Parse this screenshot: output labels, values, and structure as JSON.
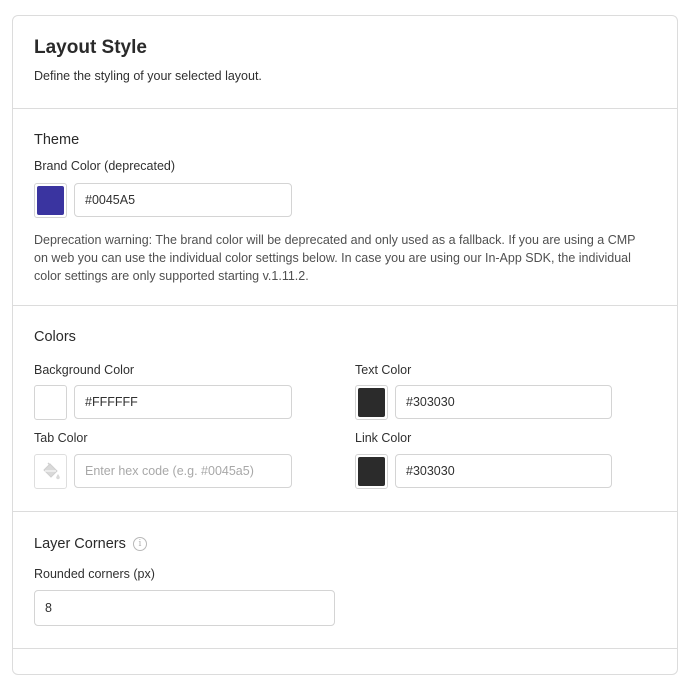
{
  "header": {
    "title": "Layout Style",
    "description": "Define the styling of your selected layout."
  },
  "theme": {
    "title": "Theme",
    "brand_color_label": "Brand Color (deprecated)",
    "brand_color_value": "#0045A5",
    "brand_swatch_color": "#3a34a0",
    "warning": "Deprecation warning: The brand color will be deprecated and only used as a fallback. If you are using a CMP on web you can use the individual color settings below. In case you are using our In-App SDK, the individual color settings are only supported starting v.1.11.2."
  },
  "colors": {
    "title": "Colors",
    "background": {
      "label": "Background Color",
      "value": "#FFFFFF",
      "swatch": "#ffffff"
    },
    "text": {
      "label": "Text Color",
      "value": "#303030",
      "swatch": "#2b2b2b"
    },
    "tab": {
      "label": "Tab Color",
      "value": "",
      "placeholder": "Enter hex code (e.g. #0045a5)",
      "icon": "paint-bucket-icon"
    },
    "link": {
      "label": "Link Color",
      "value": "#303030",
      "swatch": "#2b2b2b"
    }
  },
  "corners": {
    "title": "Layer Corners",
    "info_icon": "info-icon",
    "info_glyph": "i",
    "rounded_label": "Rounded corners (px)",
    "rounded_value": "8"
  }
}
